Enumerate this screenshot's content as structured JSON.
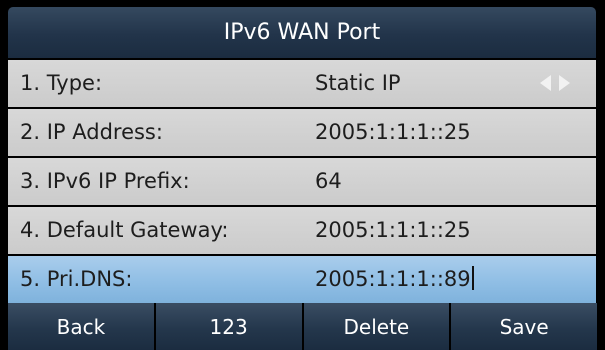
{
  "title": "IPv6 WAN Port",
  "rows": [
    {
      "label": "1. Type:",
      "value": "Static IP"
    },
    {
      "label": "2. IP Address:",
      "value": "2005:1:1:1::25"
    },
    {
      "label": "3. IPv6 IP Prefix:",
      "value": "64"
    },
    {
      "label": "4. Default Gateway:",
      "value": "2005:1:1:1::25"
    },
    {
      "label": "5. Pri.DNS:",
      "value": "2005:1:1:1::89"
    }
  ],
  "softkeys": [
    "Back",
    "123",
    "Delete",
    "Save"
  ],
  "icons": {
    "prev": "arrow-left-icon",
    "next": "arrow-right-icon"
  },
  "colors": {
    "title_bar": "#22344a",
    "row_bg": "#cfcfcf",
    "selected_row_bg": "#8ebde4",
    "softkey_bg": "#24374c"
  }
}
